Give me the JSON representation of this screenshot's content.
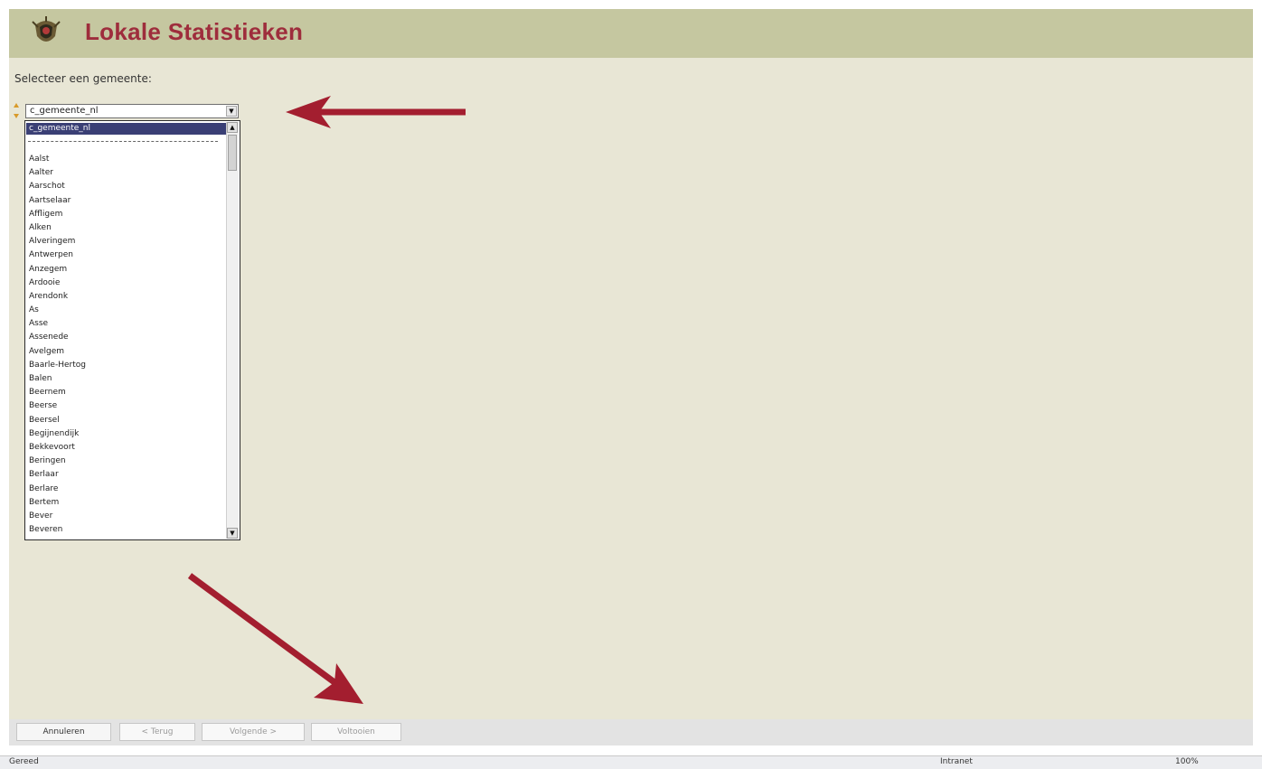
{
  "header": {
    "title": "Lokale Statistieken",
    "logo_icon": "coat-of-arms-icon"
  },
  "form": {
    "prompt": "Selecteer een gemeente:",
    "select_value": "c_gemeente_nl",
    "list": {
      "selected": "c_gemeente_nl",
      "items": [
        "Aalst",
        "Aalter",
        "Aarschot",
        "Aartselaar",
        "Affligem",
        "Alken",
        "Alveringem",
        "Antwerpen",
        "Anzegem",
        "Ardooie",
        "Arendonk",
        "As",
        "Asse",
        "Assenede",
        "Avelgem",
        "Baarle-Hertog",
        "Balen",
        "Beernem",
        "Beerse",
        "Beersel",
        "Begijnendijk",
        "Bekkevoort",
        "Beringen",
        "Berlaar",
        "Berlare",
        "Bertem",
        "Bever",
        "Beveren"
      ]
    }
  },
  "buttons": {
    "cancel": "Annuleren",
    "back": "< Terug",
    "next": "Volgende >",
    "finish": "Voltooien"
  },
  "statusbar": {
    "left": "Gereed",
    "zone": "Intranet",
    "zoom": "100%"
  },
  "colors": {
    "header_bg": "#c5c7a0",
    "title": "#9e2d3c",
    "page_bg": "#e8e6d5",
    "arrow": "#a31e2f"
  }
}
